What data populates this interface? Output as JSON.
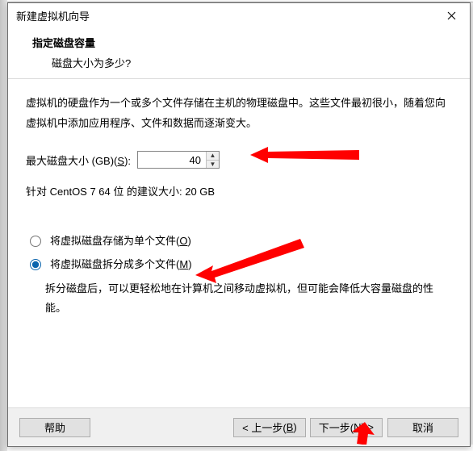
{
  "window": {
    "title": "新建虚拟机向导"
  },
  "header": {
    "heading": "指定磁盘容量",
    "subtitle": "磁盘大小为多少?"
  },
  "body": {
    "description": "虚拟机的硬盘作为一个或多个文件存储在主机的物理磁盘中。这些文件最初很小，随着您向虚拟机中添加应用程序、文件和数据而逐渐变大。",
    "max_label_prefix": "最大磁盘大小 (GB)(",
    "max_label_hotkey": "S",
    "max_label_suffix": "):",
    "max_value": "40",
    "recommend": "针对 CentOS 7 64 位 的建议大小: 20 GB"
  },
  "radios": {
    "single": {
      "prefix": "将虚拟磁盘存储为单个文件(",
      "hotkey": "O",
      "suffix": ")",
      "checked": false
    },
    "split": {
      "prefix": "将虚拟磁盘拆分成多个文件(",
      "hotkey": "M",
      "suffix": ")",
      "checked": true
    },
    "split_desc": "拆分磁盘后，可以更轻松地在计算机之间移动虚拟机，但可能会降低大容量磁盘的性能。"
  },
  "buttons": {
    "help": "帮助",
    "back_prefix": "< 上一步(",
    "back_hotkey": "B",
    "back_suffix": ")",
    "next_prefix": "下一步(",
    "next_hotkey": "N",
    "next_suffix": ") >",
    "cancel": "取消"
  },
  "icons": {
    "close": "close-icon",
    "spin_up": "chevron-up-icon",
    "spin_down": "chevron-down-icon"
  },
  "colors": {
    "annotation": "#ff0000",
    "dialog_border": "#6f6f6f",
    "footer_bg": "#f0f0f0"
  }
}
